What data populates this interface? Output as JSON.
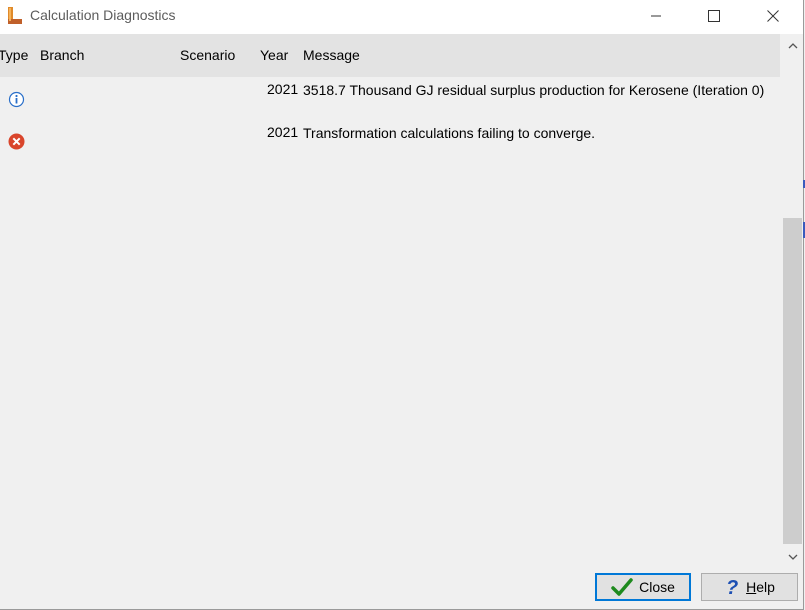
{
  "window": {
    "title": "Calculation Diagnostics",
    "controls": {
      "minimize": "minimize",
      "maximize": "maximize",
      "close": "close"
    }
  },
  "table": {
    "columns": [
      "Type",
      "Branch",
      "Scenario",
      "Year",
      "Message"
    ],
    "rows": [
      {
        "type": "info",
        "icon": "info-icon",
        "branch": "",
        "scenario": "",
        "year": "2021",
        "message": "3518.7 Thousand GJ residual surplus production for Kerosene (Iteration 0)"
      },
      {
        "type": "error",
        "icon": "error-icon",
        "branch": "",
        "scenario": "",
        "year": "2021",
        "message": "Transformation calculations failing to converge."
      }
    ]
  },
  "buttons": {
    "close_label": "Close",
    "help_label": "Help"
  },
  "colors": {
    "header_bg": "#e3e3e3",
    "accent_focus": "#0078d7",
    "error_red": "#d9452b",
    "info_blue": "#2a6fc9",
    "check_green": "#1e8a1e",
    "help_blue": "#1c4fb3"
  }
}
